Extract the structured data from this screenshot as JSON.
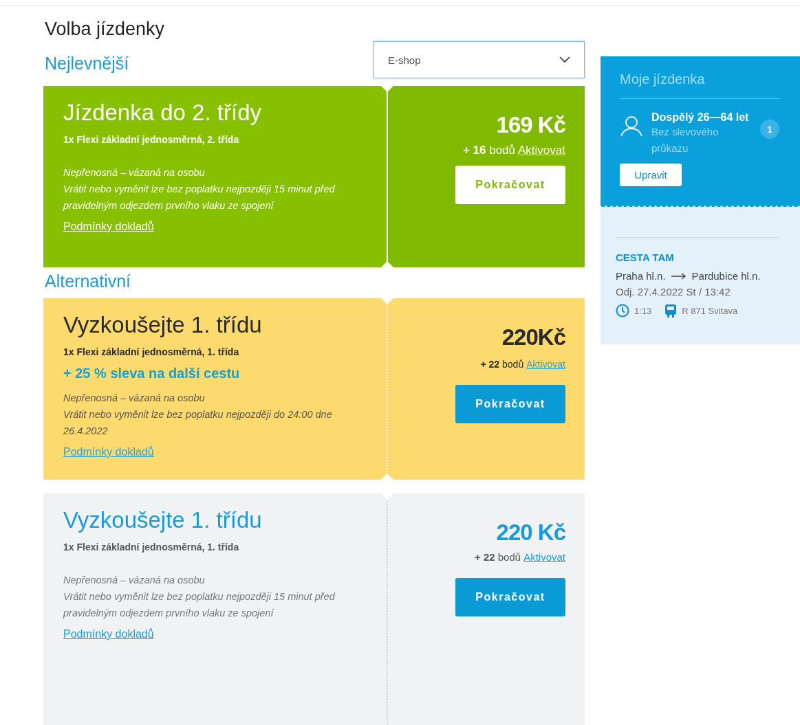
{
  "page_title": "Volba jízdenky",
  "shop_select": {
    "value": "E-shop"
  },
  "sections": [
    {
      "heading": "Nejlevnější",
      "cards": [
        {
          "kind": "green",
          "title": "Jízdenka do 2. třídy",
          "subtitle": "1x Flexi základní jednosměrná, 2. třída",
          "notes": [
            "Nepřenosná – vázaná na osobu",
            "Vrátit nebo vyměnit lze bez poplatku nejpozději 15 minut před pravidelným odjezdem prvního vlaku ze spojení"
          ],
          "conditions_link": "Podmínky dokladů",
          "price": "169 Kč",
          "points": "**+ 16** bodů",
          "activate_link": "Aktivovat",
          "button": "Pokračovat"
        }
      ]
    },
    {
      "heading": "Alternativní",
      "cards": [
        {
          "kind": "yellow",
          "title": "Vyzkoušejte 1. třídu",
          "subtitle": "1x Flexi základní jednosměrná, 1. třída",
          "bonus": "+ 25 % sleva na další cestu",
          "notes": [
            "Nepřenosná – vázaná na osobu",
            "Vrátit nebo vyměnit lze bez poplatku nejpozději do 24:00 dne 26.4.2022"
          ],
          "conditions_link": "Podmínky dokladů",
          "price": "220Kč",
          "points": "**+ 22** bodů",
          "activate_link": "Aktivovat",
          "button": "Pokračovat"
        },
        {
          "kind": "grey",
          "title": "Vyzkoušejte 1. třídu",
          "subtitle": "1x Flexi základní jednosměrná, 1. třída",
          "notes": [
            "Nepřenosná – vázaná na osobu",
            "Vrátit nebo vyměnit lze bez poplatku nejpozději 15 minut před pravidelným odjezdem prvního vlaku ze spojení"
          ],
          "conditions_link": "Podmínky dokladů",
          "price": "220 Kč",
          "points": "**+ 22** bodů",
          "activate_link": "Aktivovat",
          "button": "Pokračovat"
        }
      ]
    }
  ],
  "my_ticket": {
    "title": "Moje jízdenka",
    "passenger": {
      "name": "Dospělý 26—64 let",
      "discount": "Bez slevového průkazu",
      "count": "1"
    },
    "edit_button": "Upravit",
    "trip": {
      "heading": "CESTA TAM",
      "from": "Praha hl.n.",
      "to": "Pardubice hl.n.",
      "departure": "Odj. 27.4.2022 St / 13:42",
      "duration": "1:13",
      "train": "R 871 Svitava"
    }
  }
}
